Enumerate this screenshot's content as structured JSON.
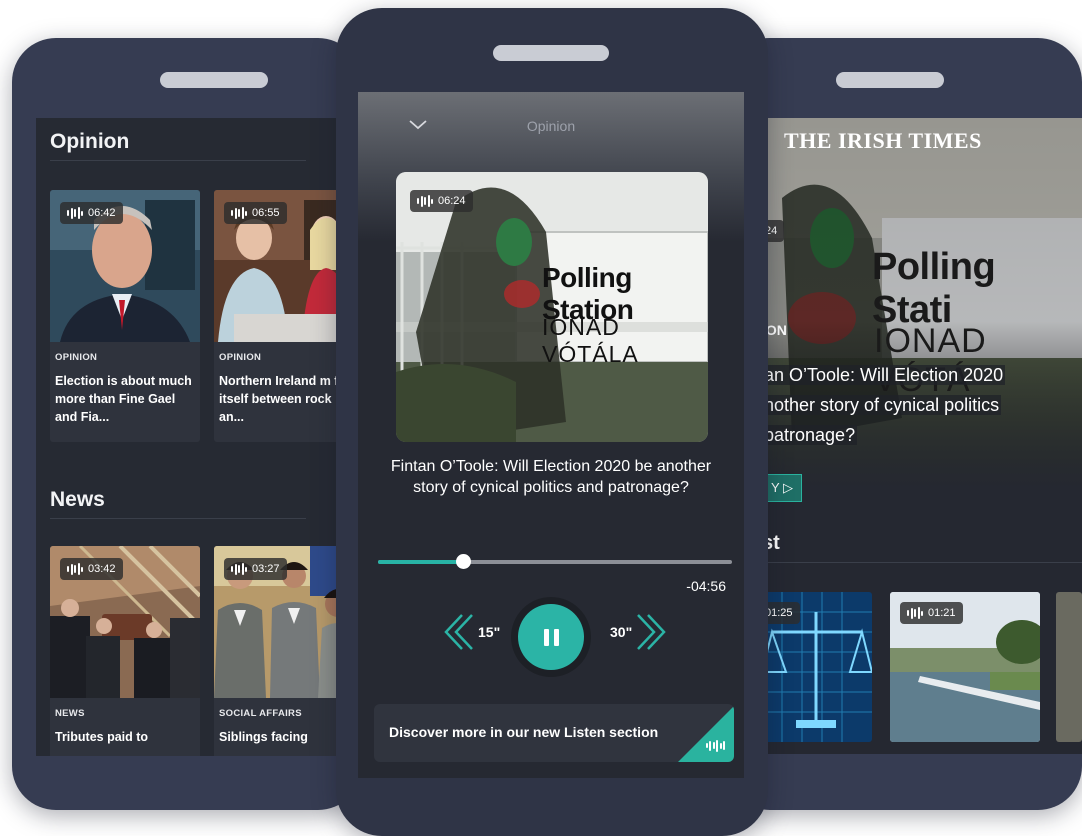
{
  "left_phone": {
    "sections": [
      {
        "title": "Opinion",
        "cards": [
          {
            "duration": "06:42",
            "category": "OPINION",
            "headline": "Election is about much more than Fine Gael and Fia..."
          },
          {
            "duration": "06:55",
            "category": "OPINION",
            "headline": "Northern Ireland m find itself between rock an..."
          }
        ]
      },
      {
        "title": "News",
        "cards": [
          {
            "duration": "03:42",
            "category": "NEWS",
            "headline": "Tributes paid to"
          },
          {
            "duration": "03:27",
            "category": "SOCIAL AFFAIRS",
            "headline": "Siblings facing"
          }
        ]
      }
    ]
  },
  "center_phone": {
    "header_title": "Opinion",
    "artwork_duration": "06:24",
    "artwork_sign_line1": "Polling Station",
    "artwork_sign_line2": "IONAD VÓTÁLA",
    "episode_title": "Fintan O’Toole: Will Election 2020 be another story of cynical politics and patronage?",
    "progress_fraction": 0.24,
    "remaining_time": "-04:56",
    "skip_back_label": "15\"",
    "skip_forward_label": "30\"",
    "discover_banner": "Discover more in our new Listen section",
    "accent_color": "#2bb4a6"
  },
  "right_phone": {
    "masthead": "THE IRISH TIMES",
    "hero_duration": ":24",
    "hero_sign_line1": "Polling Stati",
    "hero_sign_line2": "IONAD VÓTÁ",
    "category": "ION",
    "headline_lines": [
      "an O’Toole: Will Election 2020",
      "nother story of cynical politics",
      "patronage?"
    ],
    "play_label": "Y ▷",
    "section_title": "st",
    "cards": [
      {
        "duration": "01:25"
      },
      {
        "duration": "01:21"
      }
    ]
  }
}
